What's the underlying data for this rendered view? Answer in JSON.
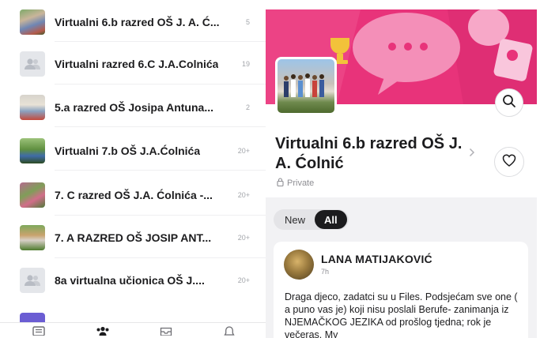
{
  "groups_list": {
    "items": [
      {
        "name": "Virtualni 6.b razred OŠ J. A. Ć...",
        "count": "5",
        "thumb": "photo"
      },
      {
        "name": "Virtualni razred 6.C J.A.Colnića",
        "count": "19",
        "thumb": "avatar"
      },
      {
        "name": "5.a razred OŠ Josipa Antuna...",
        "count": "2",
        "thumb": "photo"
      },
      {
        "name": "Virtualni 7.b OŠ J.A.Ćolnića",
        "count": "20+",
        "thumb": "photo"
      },
      {
        "name": "7. C razred OŠ J.A. Ćolnića -...",
        "count": "20+",
        "thumb": "photo"
      },
      {
        "name": "7. A RAZRED OŠ JOSIP ANT...",
        "count": "20+",
        "thumb": "photo"
      },
      {
        "name": "8a virtualna učionica  OŠ J....",
        "count": "20+",
        "thumb": "avatar"
      }
    ]
  },
  "tabbar": {
    "tabs": [
      {
        "icon": "feed-icon"
      },
      {
        "icon": "groups-icon"
      },
      {
        "icon": "inbox-icon"
      },
      {
        "icon": "bell-icon"
      }
    ]
  },
  "group": {
    "title": "Virtualni 6.b razred OŠ J. A. Ćolnić",
    "privacy": "Private",
    "cover_color": "#e8337a",
    "filters": {
      "new": "New",
      "all": "All",
      "selected": "All"
    }
  },
  "post": {
    "author": "LANA MATIJAKOVIĆ",
    "time": "7h",
    "text": "Draga djeco, zadatci su u Files. Podsjećam sve one ( a puno vas je) koji nisu poslali Berufe- zanimanja iz NJEMAČKOG JEZIKA od prošlog tjedna; rok je večeras. My"
  },
  "colors": {
    "accent": "#e8337a",
    "text": "#1c1c1e",
    "muted": "#8e8e93"
  }
}
